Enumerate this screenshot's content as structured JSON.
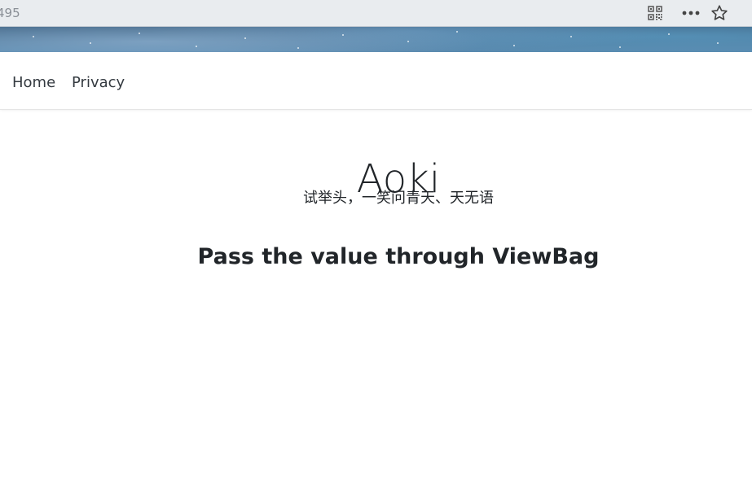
{
  "browser": {
    "address_text": "495",
    "icons": {
      "qr": "qr-code-icon",
      "more": "more-icon",
      "star": "star-icon"
    }
  },
  "nav": {
    "items": [
      {
        "label": "Home"
      },
      {
        "label": "Privacy"
      }
    ]
  },
  "main": {
    "title": "Aoki",
    "subtitle": "试举头，一笑问青天、天无语",
    "message": "Pass the value through ViewBag"
  }
}
